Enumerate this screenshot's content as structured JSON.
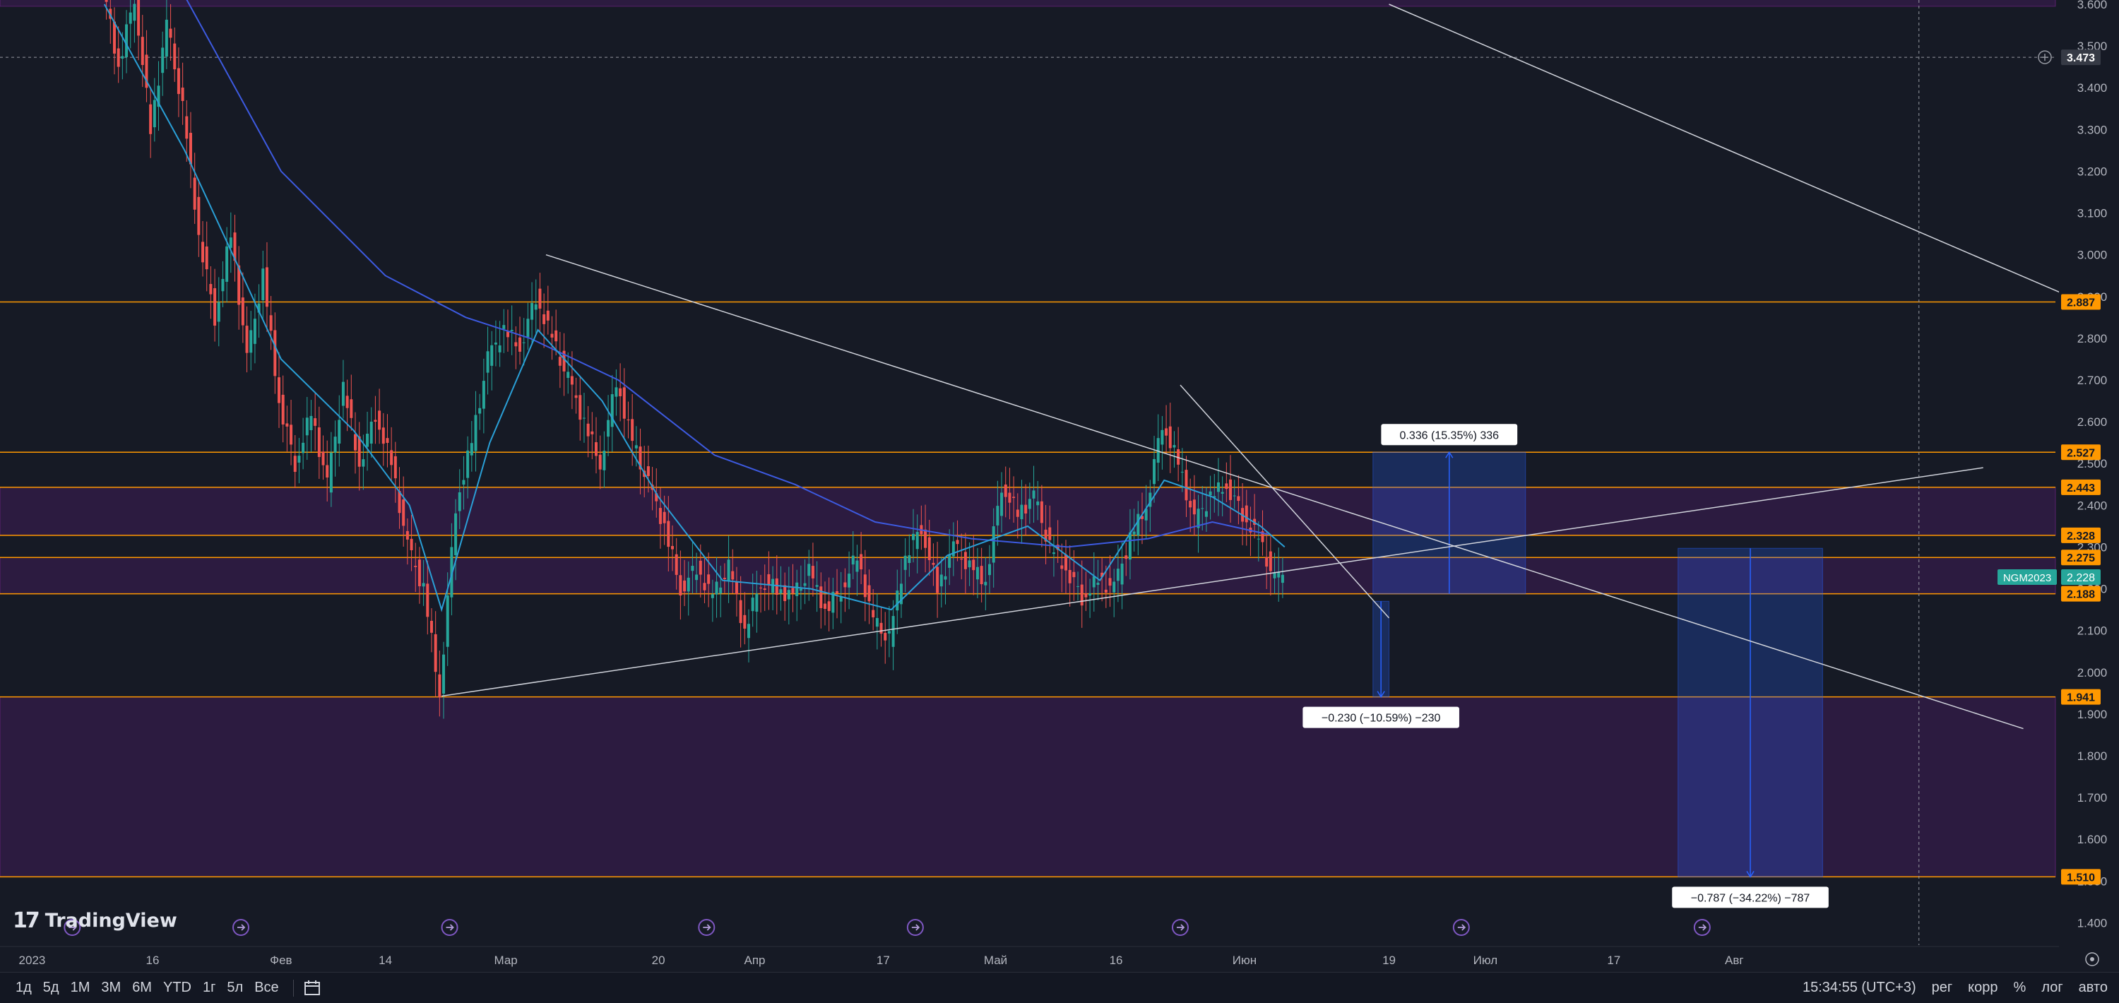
{
  "chart_data": {
    "type": "candlestick",
    "symbol": "NGM2023",
    "last_price": "2.228",
    "crosshair_price": "3.473",
    "y_axis": {
      "min": 1.35,
      "max": 3.6,
      "ticks": [
        "1.400",
        "1.500",
        "1.600",
        "1.700",
        "1.800",
        "1.900",
        "2.000",
        "2.100",
        "2.200",
        "2.300",
        "2.400",
        "2.500",
        "2.600",
        "2.700",
        "2.800",
        "2.900",
        "3.000",
        "3.100",
        "3.200",
        "3.300",
        "3.400",
        "3.500",
        "3.600"
      ]
    },
    "x_axis": {
      "start": "2022-12-28",
      "end": "2023-09-10",
      "ticks": [
        {
          "date": "2023-01-01",
          "label": "2023"
        },
        {
          "date": "2023-01-16",
          "label": "16"
        },
        {
          "date": "2023-02-01",
          "label": "Фев"
        },
        {
          "date": "2023-02-14",
          "label": "14"
        },
        {
          "date": "2023-03-01",
          "label": "Мар"
        },
        {
          "date": "2023-03-20",
          "label": "20"
        },
        {
          "date": "2023-04-01",
          "label": "Апр"
        },
        {
          "date": "2023-04-17",
          "label": "17"
        },
        {
          "date": "2023-05-01",
          "label": "Май"
        },
        {
          "date": "2023-05-16",
          "label": "16"
        },
        {
          "date": "2023-06-01",
          "label": "Июн"
        },
        {
          "date": "2023-06-19",
          "label": "19"
        },
        {
          "date": "2023-07-01",
          "label": "Июл"
        },
        {
          "date": "2023-07-17",
          "label": "17"
        },
        {
          "date": "2023-08-01",
          "label": "Авг"
        }
      ]
    },
    "price_path": [
      [
        "2023-01-10",
        3.65
      ],
      [
        "2023-01-12",
        3.45
      ],
      [
        "2023-01-14",
        3.62
      ],
      [
        "2023-01-16",
        3.3
      ],
      [
        "2023-01-18",
        3.55
      ],
      [
        "2023-01-20",
        3.35
      ],
      [
        "2023-01-22",
        3.05
      ],
      [
        "2023-01-24",
        2.85
      ],
      [
        "2023-01-26",
        3.05
      ],
      [
        "2023-01-28",
        2.75
      ],
      [
        "2023-01-30",
        2.95
      ],
      [
        "2023-02-01",
        2.65
      ],
      [
        "2023-02-03",
        2.5
      ],
      [
        "2023-02-05",
        2.62
      ],
      [
        "2023-02-07",
        2.45
      ],
      [
        "2023-02-09",
        2.68
      ],
      [
        "2023-02-11",
        2.5
      ],
      [
        "2023-02-13",
        2.62
      ],
      [
        "2023-02-15",
        2.5
      ],
      [
        "2023-02-17",
        2.3
      ],
      [
        "2023-02-19",
        2.2
      ],
      [
        "2023-02-21",
        1.95
      ],
      [
        "2023-02-23",
        2.4
      ],
      [
        "2023-02-25",
        2.55
      ],
      [
        "2023-02-27",
        2.75
      ],
      [
        "2023-03-01",
        2.82
      ],
      [
        "2023-03-03",
        2.78
      ],
      [
        "2023-03-05",
        2.9
      ],
      [
        "2023-03-07",
        2.8
      ],
      [
        "2023-03-09",
        2.7
      ],
      [
        "2023-03-11",
        2.6
      ],
      [
        "2023-03-13",
        2.5
      ],
      [
        "2023-03-15",
        2.7
      ],
      [
        "2023-03-17",
        2.55
      ],
      [
        "2023-03-19",
        2.45
      ],
      [
        "2023-03-21",
        2.35
      ],
      [
        "2023-03-23",
        2.2
      ],
      [
        "2023-03-25",
        2.25
      ],
      [
        "2023-03-27",
        2.18
      ],
      [
        "2023-03-29",
        2.25
      ],
      [
        "2023-03-31",
        2.1
      ],
      [
        "2023-04-02",
        2.22
      ],
      [
        "2023-04-04",
        2.2
      ],
      [
        "2023-04-06",
        2.18
      ],
      [
        "2023-04-08",
        2.24
      ],
      [
        "2023-04-10",
        2.15
      ],
      [
        "2023-04-12",
        2.2
      ],
      [
        "2023-04-14",
        2.28
      ],
      [
        "2023-04-16",
        2.12
      ],
      [
        "2023-04-18",
        2.08
      ],
      [
        "2023-04-20",
        2.28
      ],
      [
        "2023-04-22",
        2.35
      ],
      [
        "2023-04-24",
        2.2
      ],
      [
        "2023-04-26",
        2.3
      ],
      [
        "2023-04-28",
        2.25
      ],
      [
        "2023-04-30",
        2.22
      ],
      [
        "2023-05-02",
        2.45
      ],
      [
        "2023-05-04",
        2.38
      ],
      [
        "2023-05-06",
        2.42
      ],
      [
        "2023-05-08",
        2.3
      ],
      [
        "2023-05-10",
        2.25
      ],
      [
        "2023-05-12",
        2.18
      ],
      [
        "2023-05-14",
        2.22
      ],
      [
        "2023-05-16",
        2.2
      ],
      [
        "2023-05-18",
        2.32
      ],
      [
        "2023-05-20",
        2.4
      ],
      [
        "2023-05-22",
        2.6
      ],
      [
        "2023-05-24",
        2.5
      ],
      [
        "2023-05-26",
        2.36
      ],
      [
        "2023-05-28",
        2.42
      ],
      [
        "2023-05-30",
        2.45
      ],
      [
        "2023-06-01",
        2.38
      ],
      [
        "2023-06-03",
        2.32
      ],
      [
        "2023-06-05",
        2.22
      ],
      [
        "2023-06-06",
        2.228
      ]
    ],
    "moving_average_fast": [
      [
        "2023-01-10",
        3.6
      ],
      [
        "2023-01-20",
        3.25
      ],
      [
        "2023-02-01",
        2.75
      ],
      [
        "2023-02-10",
        2.58
      ],
      [
        "2023-02-17",
        2.4
      ],
      [
        "2023-02-21",
        2.15
      ],
      [
        "2023-02-27",
        2.55
      ],
      [
        "2023-03-05",
        2.82
      ],
      [
        "2023-03-13",
        2.65
      ],
      [
        "2023-03-20",
        2.42
      ],
      [
        "2023-03-28",
        2.22
      ],
      [
        "2023-04-08",
        2.2
      ],
      [
        "2023-04-18",
        2.15
      ],
      [
        "2023-04-25",
        2.28
      ],
      [
        "2023-05-05",
        2.35
      ],
      [
        "2023-05-14",
        2.22
      ],
      [
        "2023-05-22",
        2.46
      ],
      [
        "2023-05-28",
        2.42
      ],
      [
        "2023-06-03",
        2.35
      ],
      [
        "2023-06-06",
        2.3
      ]
    ],
    "moving_average_slow": [
      [
        "2023-01-20",
        3.62
      ],
      [
        "2023-02-01",
        3.2
      ],
      [
        "2023-02-14",
        2.95
      ],
      [
        "2023-02-24",
        2.85
      ],
      [
        "2023-03-04",
        2.8
      ],
      [
        "2023-03-15",
        2.7
      ],
      [
        "2023-03-27",
        2.52
      ],
      [
        "2023-04-06",
        2.45
      ],
      [
        "2023-04-16",
        2.36
      ],
      [
        "2023-04-28",
        2.32
      ],
      [
        "2023-05-10",
        2.3
      ],
      [
        "2023-05-20",
        2.32
      ],
      [
        "2023-05-28",
        2.36
      ],
      [
        "2023-06-04",
        2.33
      ]
    ],
    "horizontal_levels": [
      {
        "price": 2.887,
        "label": "2.887",
        "color": "#ff9800"
      },
      {
        "price": 2.527,
        "label": "2.527",
        "color": "#ff9800"
      },
      {
        "price": 2.443,
        "label": "2.443",
        "color": "#ff9800"
      },
      {
        "price": 2.328,
        "label": "2.328",
        "color": "#ff9800"
      },
      {
        "price": 2.275,
        "label": "2.275",
        "color": "#ff9800"
      },
      {
        "price": 2.188,
        "label": "2.188",
        "color": "#ff9800"
      },
      {
        "price": 1.941,
        "label": "1.941",
        "color": "#ff9800"
      },
      {
        "price": 1.51,
        "label": "1.510",
        "color": "#ff9800"
      }
    ],
    "zones": [
      {
        "from": 3.595,
        "to": 3.65
      },
      {
        "from": 2.328,
        "to": 2.443
      },
      {
        "from": 2.188,
        "to": 2.275
      },
      {
        "from": 1.51,
        "to": 1.941
      }
    ],
    "trend_lines": [
      {
        "from": [
          "2023-03-06",
          3.0
        ],
        "to": [
          "2023-09-06",
          1.865
        ]
      },
      {
        "from": [
          "2023-02-21",
          1.943
        ],
        "to": [
          "2023-09-01",
          2.49
        ]
      },
      {
        "from": [
          "2023-05-24",
          2.688
        ],
        "to": [
          "2023-06-19",
          2.13
        ]
      },
      {
        "from": [
          "2023-06-19",
          3.6
        ],
        "to": [
          "2023-09-12",
          2.898
        ]
      }
    ],
    "measurements": [
      {
        "from_date": "2023-06-17",
        "to_date": "2023-07-06",
        "from_price": 2.188,
        "to_price": 2.527,
        "label": "0.336 (15.35%) 336"
      },
      {
        "from_date": "2023-06-17",
        "to_date": "2023-06-19",
        "from_price": 2.17,
        "to_price": 1.941,
        "label": "−0.230 (−10.59%) −230"
      },
      {
        "from_date": "2023-07-25",
        "to_date": "2023-08-12",
        "from_price": 2.297,
        "to_price": 1.51,
        "label": "−0.787 (−34.22%) −787"
      }
    ],
    "event_markers": [
      "2023-01-06",
      "2023-01-27",
      "2023-02-22",
      "2023-03-26",
      "2023-04-21",
      "2023-05-24",
      "2023-06-28",
      "2023-07-28"
    ],
    "crosshair_date": "2023-08-24",
    "grid": false
  },
  "toolbar": {
    "timeframes": [
      "1д",
      "5д",
      "1М",
      "3М",
      "6М",
      "YTD",
      "1г",
      "5л",
      "Все"
    ],
    "time": "15:34:55 (UTC+3)",
    "options": [
      "рег",
      "корр",
      "%",
      "лог",
      "авто"
    ]
  },
  "brand": {
    "name": "TradingView"
  },
  "colors": {
    "background": "#161a25",
    "candle_up": "#26a69a",
    "candle_down": "#ef5350",
    "ma_fast": "#2a9fd6",
    "ma_slow": "#3d5ae0",
    "level": "#ff9800",
    "zone": "rgba(123,31,162,0.22)",
    "measure": "rgba(41,98,255,0.25)",
    "symbol_tag": "#26a69a"
  }
}
